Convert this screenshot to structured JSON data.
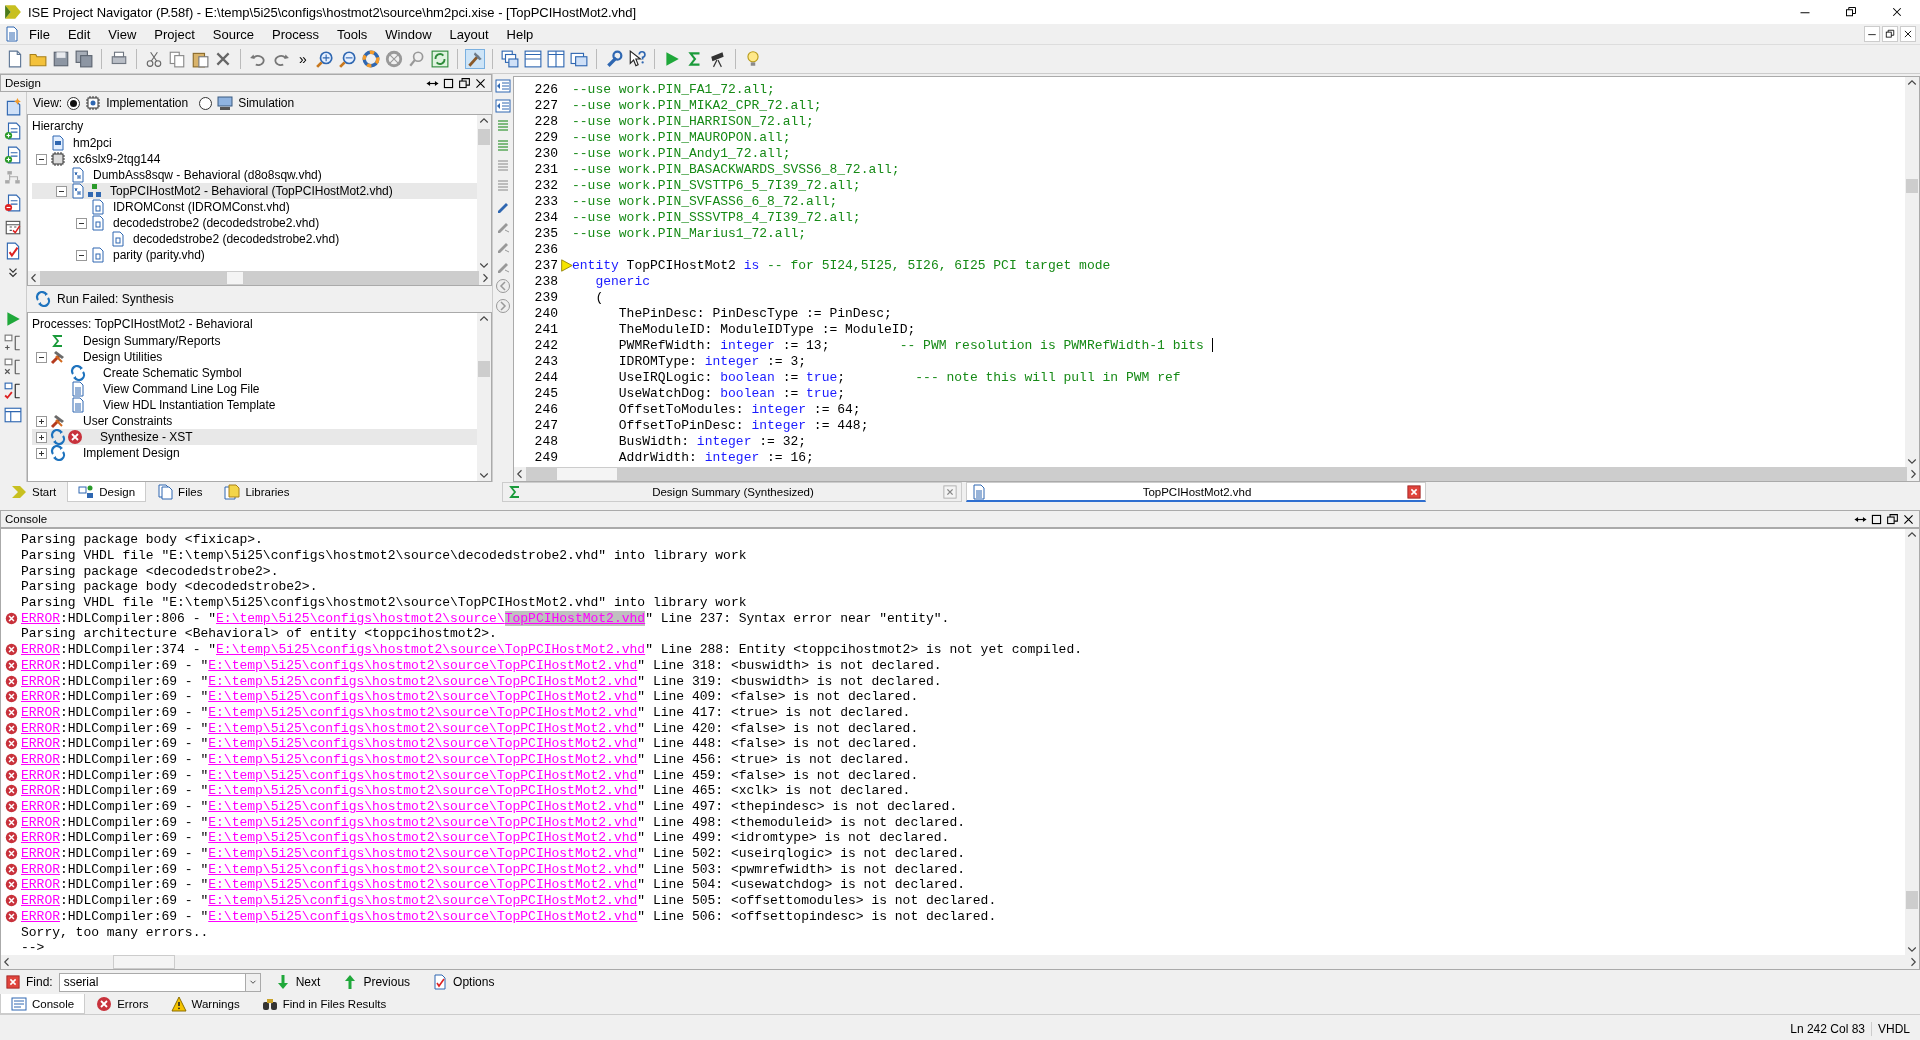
{
  "window": {
    "title": "ISE Project Navigator (P.58f) - E:\\temp\\5i25\\configs\\hostmot2\\source\\hm2pci.xise - [TopPCIHostMot2.vhd]"
  },
  "menu": [
    "File",
    "Edit",
    "View",
    "Project",
    "Source",
    "Process",
    "Tools",
    "Window",
    "Layout",
    "Help"
  ],
  "toolbar": {
    "overflow": "»"
  },
  "design_panel": {
    "title": "Design",
    "view_label": "View:",
    "views": [
      {
        "label": "Implementation",
        "kind": "implementation",
        "selected": true
      },
      {
        "label": "Simulation",
        "kind": "simulation",
        "selected": false
      }
    ],
    "hierarchy": {
      "title": "Hierarchy",
      "items": [
        {
          "label": "hm2pci",
          "kind": "project",
          "selected": false
        },
        {
          "label": "xc6slx9-2tqg144",
          "kind": "chip",
          "expanded": true,
          "selected": false,
          "children": [
            {
              "label": "DumbAss8sqw - Behavioral (d8o8sqw.vhd)",
              "kind": "vhdl",
              "selected": false
            },
            {
              "label": "TopPCIHostMot2 - Behavioral (TopPCIHostMot2.vhd)",
              "kind": "top",
              "expanded": true,
              "selected": true,
              "children": [
                {
                  "label": "IDROMConst (IDROMConst.vhd)",
                  "kind": "package",
                  "selected": false
                },
                {
                  "label": "decodedstrobe2 (decodedstrobe2.vhd)",
                  "kind": "package",
                  "expanded": true,
                  "selected": false,
                  "children": [
                    {
                      "label": "decodedstrobe2 (decodedstrobe2.vhd)",
                      "kind": "package",
                      "selected": false
                    }
                  ]
                },
                {
                  "label": "parity (parity.vhd)",
                  "kind": "package",
                  "expanded": true,
                  "selected": false
                }
              ]
            }
          ]
        }
      ]
    },
    "run_status": "Run Failed: Synthesis",
    "processes": {
      "title": "Processes: TopPCIHostMot2 - Behavioral",
      "items": [
        {
          "label": "Design Summary/Reports",
          "kind": "summary",
          "failed": false,
          "selected": false
        },
        {
          "label": "Design Utilities",
          "kind": "tools",
          "failed": false,
          "expanded": true,
          "selected": false,
          "children": [
            {
              "label": "Create Schematic Symbol",
              "kind": "process",
              "failed": false,
              "selected": false
            },
            {
              "label": "View Command Line Log File",
              "kind": "document",
              "failed": false,
              "selected": false
            },
            {
              "label": "View HDL Instantiation Template",
              "kind": "document",
              "failed": false,
              "selected": false
            }
          ]
        },
        {
          "label": "User Constraints",
          "kind": "tools",
          "failed": false,
          "expanded": false,
          "selected": false
        },
        {
          "label": "Synthesize - XST",
          "kind": "process",
          "failed": true,
          "expanded": false,
          "selected": true
        },
        {
          "label": "Implement Design",
          "kind": "process",
          "failed": false,
          "expanded": false,
          "selected": false
        }
      ]
    }
  },
  "panel_tabs": [
    {
      "label": "Start",
      "kind": "start",
      "selected": false
    },
    {
      "label": "Design",
      "kind": "design",
      "selected": true
    },
    {
      "label": "Files",
      "kind": "files",
      "selected": false
    },
    {
      "label": "Libraries",
      "kind": "libraries",
      "selected": false
    }
  ],
  "editor": {
    "lines": [
      {
        "number": "226",
        "marker": false,
        "cursor": false,
        "segments": [
          {
            "kind": "comment",
            "text": "--use work.PIN_FA1_72.all;"
          }
        ]
      },
      {
        "number": "227",
        "marker": false,
        "cursor": false,
        "segments": [
          {
            "kind": "comment",
            "text": "--use work.PIN_MIKA2_CPR_72.all;"
          }
        ]
      },
      {
        "number": "228",
        "marker": false,
        "cursor": false,
        "segments": [
          {
            "kind": "comment",
            "text": "--use work.PIN_HARRISON_72.all;"
          }
        ]
      },
      {
        "number": "229",
        "marker": false,
        "cursor": false,
        "segments": [
          {
            "kind": "comment",
            "text": "--use work.PIN_MAUROPON.all;"
          }
        ]
      },
      {
        "number": "230",
        "marker": false,
        "cursor": false,
        "segments": [
          {
            "kind": "comment",
            "text": "--use work.PIN_Andy1_72.all;"
          }
        ]
      },
      {
        "number": "231",
        "marker": false,
        "cursor": false,
        "segments": [
          {
            "kind": "comment",
            "text": "--use work.PIN_BASACKWARDS_SVSS6_8_72.all;"
          }
        ]
      },
      {
        "number": "232",
        "marker": false,
        "cursor": false,
        "segments": [
          {
            "kind": "comment",
            "text": "--use work.PIN_SVSTTP6_5_7I39_72.all;"
          }
        ]
      },
      {
        "number": "233",
        "marker": false,
        "cursor": false,
        "segments": [
          {
            "kind": "comment",
            "text": "--use work.PIN_SVFASS6_6_8_72.all;"
          }
        ]
      },
      {
        "number": "234",
        "marker": false,
        "cursor": false,
        "segments": [
          {
            "kind": "comment",
            "text": "--use work.PIN_SSSVTP8_4_7I39_72.all;"
          }
        ]
      },
      {
        "number": "235",
        "marker": false,
        "cursor": false,
        "segments": [
          {
            "kind": "comment",
            "text": "--use work.PIN_Marius1_72.all;"
          }
        ]
      },
      {
        "number": "236",
        "marker": false,
        "cursor": false
      },
      {
        "number": "237",
        "marker": true,
        "cursor": false,
        "segments": [
          {
            "kind": "keyword",
            "text": "entity"
          },
          {
            "kind": "plain",
            "text": " TopPCIHostMot2 "
          },
          {
            "kind": "keyword",
            "text": "is"
          },
          {
            "kind": "comment",
            "text": " -- for 5I24,5I25, 5I26, 6I25 PCI target mode"
          }
        ]
      },
      {
        "number": "238",
        "marker": false,
        "cursor": false,
        "segments": [
          {
            "kind": "keyword",
            "text": "   generic"
          }
        ]
      },
      {
        "number": "239",
        "marker": false,
        "cursor": false,
        "segments": [
          {
            "kind": "plain",
            "text": "   ("
          }
        ]
      },
      {
        "number": "240",
        "marker": false,
        "cursor": false,
        "segments": [
          {
            "kind": "plain",
            "text": "      ThePinDesc: PinDescType := PinDesc;"
          }
        ]
      },
      {
        "number": "241",
        "marker": false,
        "cursor": false,
        "segments": [
          {
            "kind": "plain",
            "text": "      TheModuleID: ModuleIDType := ModuleID;"
          }
        ]
      },
      {
        "number": "242",
        "marker": false,
        "cursor": true,
        "segments": [
          {
            "kind": "plain",
            "text": "      PWMRefWidth: "
          },
          {
            "kind": "keyword",
            "text": "integer"
          },
          {
            "kind": "plain",
            "text": " := 13;         "
          },
          {
            "kind": "comment",
            "text": "-- PWM resolution is PWMRefWidth-1 bits"
          }
        ]
      },
      {
        "number": "243",
        "marker": false,
        "cursor": false,
        "segments": [
          {
            "kind": "plain",
            "text": "      IDROMType: "
          },
          {
            "kind": "keyword",
            "text": "integer"
          },
          {
            "kind": "plain",
            "text": " := 3;"
          }
        ]
      },
      {
        "number": "244",
        "marker": false,
        "cursor": false,
        "segments": [
          {
            "kind": "plain",
            "text": "      UseIRQLogic: "
          },
          {
            "kind": "keyword",
            "text": "boolean"
          },
          {
            "kind": "plain",
            "text": " := "
          },
          {
            "kind": "keyword",
            "text": "true"
          },
          {
            "kind": "plain",
            "text": ";         "
          },
          {
            "kind": "comment",
            "text": "--- note this will pull in PWM ref"
          }
        ]
      },
      {
        "number": "245",
        "marker": false,
        "cursor": false,
        "segments": [
          {
            "kind": "plain",
            "text": "      UseWatchDog: "
          },
          {
            "kind": "keyword",
            "text": "boolean"
          },
          {
            "kind": "plain",
            "text": " := "
          },
          {
            "kind": "keyword",
            "text": "true"
          },
          {
            "kind": "plain",
            "text": ";"
          }
        ]
      },
      {
        "number": "246",
        "marker": false,
        "cursor": false,
        "segments": [
          {
            "kind": "plain",
            "text": "      OffsetToModules: "
          },
          {
            "kind": "keyword",
            "text": "integer"
          },
          {
            "kind": "plain",
            "text": " := 64;"
          }
        ]
      },
      {
        "number": "247",
        "marker": false,
        "cursor": false,
        "segments": [
          {
            "kind": "plain",
            "text": "      OffsetToPinDesc: "
          },
          {
            "kind": "keyword",
            "text": "integer"
          },
          {
            "kind": "plain",
            "text": " := 448;"
          }
        ]
      },
      {
        "number": "248",
        "marker": false,
        "cursor": false,
        "segments": [
          {
            "kind": "plain",
            "text": "      BusWidth: "
          },
          {
            "kind": "keyword",
            "text": "integer"
          },
          {
            "kind": "plain",
            "text": " := 32;"
          }
        ]
      },
      {
        "number": "249",
        "marker": false,
        "cursor": false,
        "segments": [
          {
            "kind": "plain",
            "text": "      AddrWidth: "
          },
          {
            "kind": "keyword",
            "text": "integer"
          },
          {
            "kind": "plain",
            "text": " := 16;"
          }
        ]
      }
    ]
  },
  "editor_tabs": [
    {
      "label": "Design Summary (Synthesized)",
      "kind": "summary",
      "selected": false
    },
    {
      "label": "TopPCIHostMot2.vhd",
      "kind": "file",
      "selected": true
    }
  ],
  "console": {
    "title": "Console",
    "lines": [
      {
        "kind": "info",
        "text": "Parsing package body <fixicap>."
      },
      {
        "kind": "info",
        "text": "Parsing VHDL file \"E:\\temp\\5i25\\configs\\hostmot2\\source\\decodedstrobe2.vhd\" into library work"
      },
      {
        "kind": "info",
        "text": "Parsing package <decodedstrobe2>."
      },
      {
        "kind": "info",
        "text": "Parsing package body <decodedstrobe2>."
      },
      {
        "kind": "info",
        "text": "Parsing VHDL file \"E:\\temp\\5i25\\configs\\hostmot2\\source\\TopPCIHostMot2.vhd\" into library work"
      },
      {
        "kind": "error",
        "label": "ERROR",
        "code": ":HDLCompiler:806 - \"",
        "path": "E:\\temp\\5i25\\configs\\hostmot2\\source\\",
        "file": "TopPCIHostMot2.vhd",
        "file_selected": true,
        "message": "\" Line 237: Syntax error near \"entity\"."
      },
      {
        "kind": "info",
        "text": "Parsing architecture <Behavioral> of entity <toppcihostmot2>."
      },
      {
        "kind": "error",
        "label": "ERROR",
        "code": ":HDLCompiler:374 - \"",
        "path": "E:\\temp\\5i25\\configs\\hostmot2\\source\\",
        "file": "TopPCIHostMot2.vhd",
        "file_selected": false,
        "message": "\" Line 288: Entity <toppcihostmot2> is not yet compiled."
      },
      {
        "kind": "error",
        "label": "ERROR",
        "code": ":HDLCompiler:69 - \"",
        "path": "E:\\temp\\5i25\\configs\\hostmot2\\source\\",
        "file": "TopPCIHostMot2.vhd",
        "file_selected": false,
        "message": "\" Line 318: <buswidth> is not declared."
      },
      {
        "kind": "error",
        "label": "ERROR",
        "code": ":HDLCompiler:69 - \"",
        "path": "E:\\temp\\5i25\\configs\\hostmot2\\source\\",
        "file": "TopPCIHostMot2.vhd",
        "file_selected": false,
        "message": "\" Line 319: <buswidth> is not declared."
      },
      {
        "kind": "error",
        "label": "ERROR",
        "code": ":HDLCompiler:69 - \"",
        "path": "E:\\temp\\5i25\\configs\\hostmot2\\source\\",
        "file": "TopPCIHostMot2.vhd",
        "file_selected": false,
        "message": "\" Line 409: <false> is not declared."
      },
      {
        "kind": "error",
        "label": "ERROR",
        "code": ":HDLCompiler:69 - \"",
        "path": "E:\\temp\\5i25\\configs\\hostmot2\\source\\",
        "file": "TopPCIHostMot2.vhd",
        "file_selected": false,
        "message": "\" Line 417: <true> is not declared."
      },
      {
        "kind": "error",
        "label": "ERROR",
        "code": ":HDLCompiler:69 - \"",
        "path": "E:\\temp\\5i25\\configs\\hostmot2\\source\\",
        "file": "TopPCIHostMot2.vhd",
        "file_selected": false,
        "message": "\" Line 420: <false> is not declared."
      },
      {
        "kind": "error",
        "label": "ERROR",
        "code": ":HDLCompiler:69 - \"",
        "path": "E:\\temp\\5i25\\configs\\hostmot2\\source\\",
        "file": "TopPCIHostMot2.vhd",
        "file_selected": false,
        "message": "\" Line 448: <false> is not declared."
      },
      {
        "kind": "error",
        "label": "ERROR",
        "code": ":HDLCompiler:69 - \"",
        "path": "E:\\temp\\5i25\\configs\\hostmot2\\source\\",
        "file": "TopPCIHostMot2.vhd",
        "file_selected": false,
        "message": "\" Line 456: <true> is not declared."
      },
      {
        "kind": "error",
        "label": "ERROR",
        "code": ":HDLCompiler:69 - \"",
        "path": "E:\\temp\\5i25\\configs\\hostmot2\\source\\",
        "file": "TopPCIHostMot2.vhd",
        "file_selected": false,
        "message": "\" Line 459: <false> is not declared."
      },
      {
        "kind": "error",
        "label": "ERROR",
        "code": ":HDLCompiler:69 - \"",
        "path": "E:\\temp\\5i25\\configs\\hostmot2\\source\\",
        "file": "TopPCIHostMot2.vhd",
        "file_selected": false,
        "message": "\" Line 465: <xclk> is not declared."
      },
      {
        "kind": "error",
        "label": "ERROR",
        "code": ":HDLCompiler:69 - \"",
        "path": "E:\\temp\\5i25\\configs\\hostmot2\\source\\",
        "file": "TopPCIHostMot2.vhd",
        "file_selected": false,
        "message": "\" Line 497: <thepindesc> is not declared."
      },
      {
        "kind": "error",
        "label": "ERROR",
        "code": ":HDLCompiler:69 - \"",
        "path": "E:\\temp\\5i25\\configs\\hostmot2\\source\\",
        "file": "TopPCIHostMot2.vhd",
        "file_selected": false,
        "message": "\" Line 498: <themoduleid> is not declared."
      },
      {
        "kind": "error",
        "label": "ERROR",
        "code": ":HDLCompiler:69 - \"",
        "path": "E:\\temp\\5i25\\configs\\hostmot2\\source\\",
        "file": "TopPCIHostMot2.vhd",
        "file_selected": false,
        "message": "\" Line 499: <idromtype> is not declared."
      },
      {
        "kind": "error",
        "label": "ERROR",
        "code": ":HDLCompiler:69 - \"",
        "path": "E:\\temp\\5i25\\configs\\hostmot2\\source\\",
        "file": "TopPCIHostMot2.vhd",
        "file_selected": false,
        "message": "\" Line 502: <useirqlogic> is not declared."
      },
      {
        "kind": "error",
        "label": "ERROR",
        "code": ":HDLCompiler:69 - \"",
        "path": "E:\\temp\\5i25\\configs\\hostmot2\\source\\",
        "file": "TopPCIHostMot2.vhd",
        "file_selected": false,
        "message": "\" Line 503: <pwmrefwidth> is not declared."
      },
      {
        "kind": "error",
        "label": "ERROR",
        "code": ":HDLCompiler:69 - \"",
        "path": "E:\\temp\\5i25\\configs\\hostmot2\\source\\",
        "file": "TopPCIHostMot2.vhd",
        "file_selected": false,
        "message": "\" Line 504: <usewatchdog> is not declared."
      },
      {
        "kind": "error",
        "label": "ERROR",
        "code": ":HDLCompiler:69 - \"",
        "path": "E:\\temp\\5i25\\configs\\hostmot2\\source\\",
        "file": "TopPCIHostMot2.vhd",
        "file_selected": false,
        "message": "\" Line 505: <offsettomodules> is not declared."
      },
      {
        "kind": "error",
        "label": "ERROR",
        "code": ":HDLCompiler:69 - \"",
        "path": "E:\\temp\\5i25\\configs\\hostmot2\\source\\",
        "file": "TopPCIHostMot2.vhd",
        "file_selected": false,
        "message": "\" Line 506: <offsettopindesc> is not declared."
      },
      {
        "kind": "info",
        "text": "Sorry, too many errors.."
      },
      {
        "kind": "info",
        "text": "-->"
      }
    ]
  },
  "find_bar": {
    "label": "Find:",
    "value": "sserial",
    "buttons": [
      {
        "label": "Next",
        "kind": "next"
      },
      {
        "label": "Previous",
        "kind": "previous"
      },
      {
        "label": "Options",
        "kind": "options"
      }
    ]
  },
  "console_tabs": [
    {
      "label": "Console",
      "kind": "console",
      "selected": true
    },
    {
      "label": "Errors",
      "kind": "errors",
      "selected": false
    },
    {
      "label": "Warnings",
      "kind": "warnings",
      "selected": false
    },
    {
      "label": "Find in Files Results",
      "kind": "find",
      "selected": false
    }
  ],
  "status_bar": {
    "position": "Ln 242 Col 83",
    "language": "VHDL"
  }
}
